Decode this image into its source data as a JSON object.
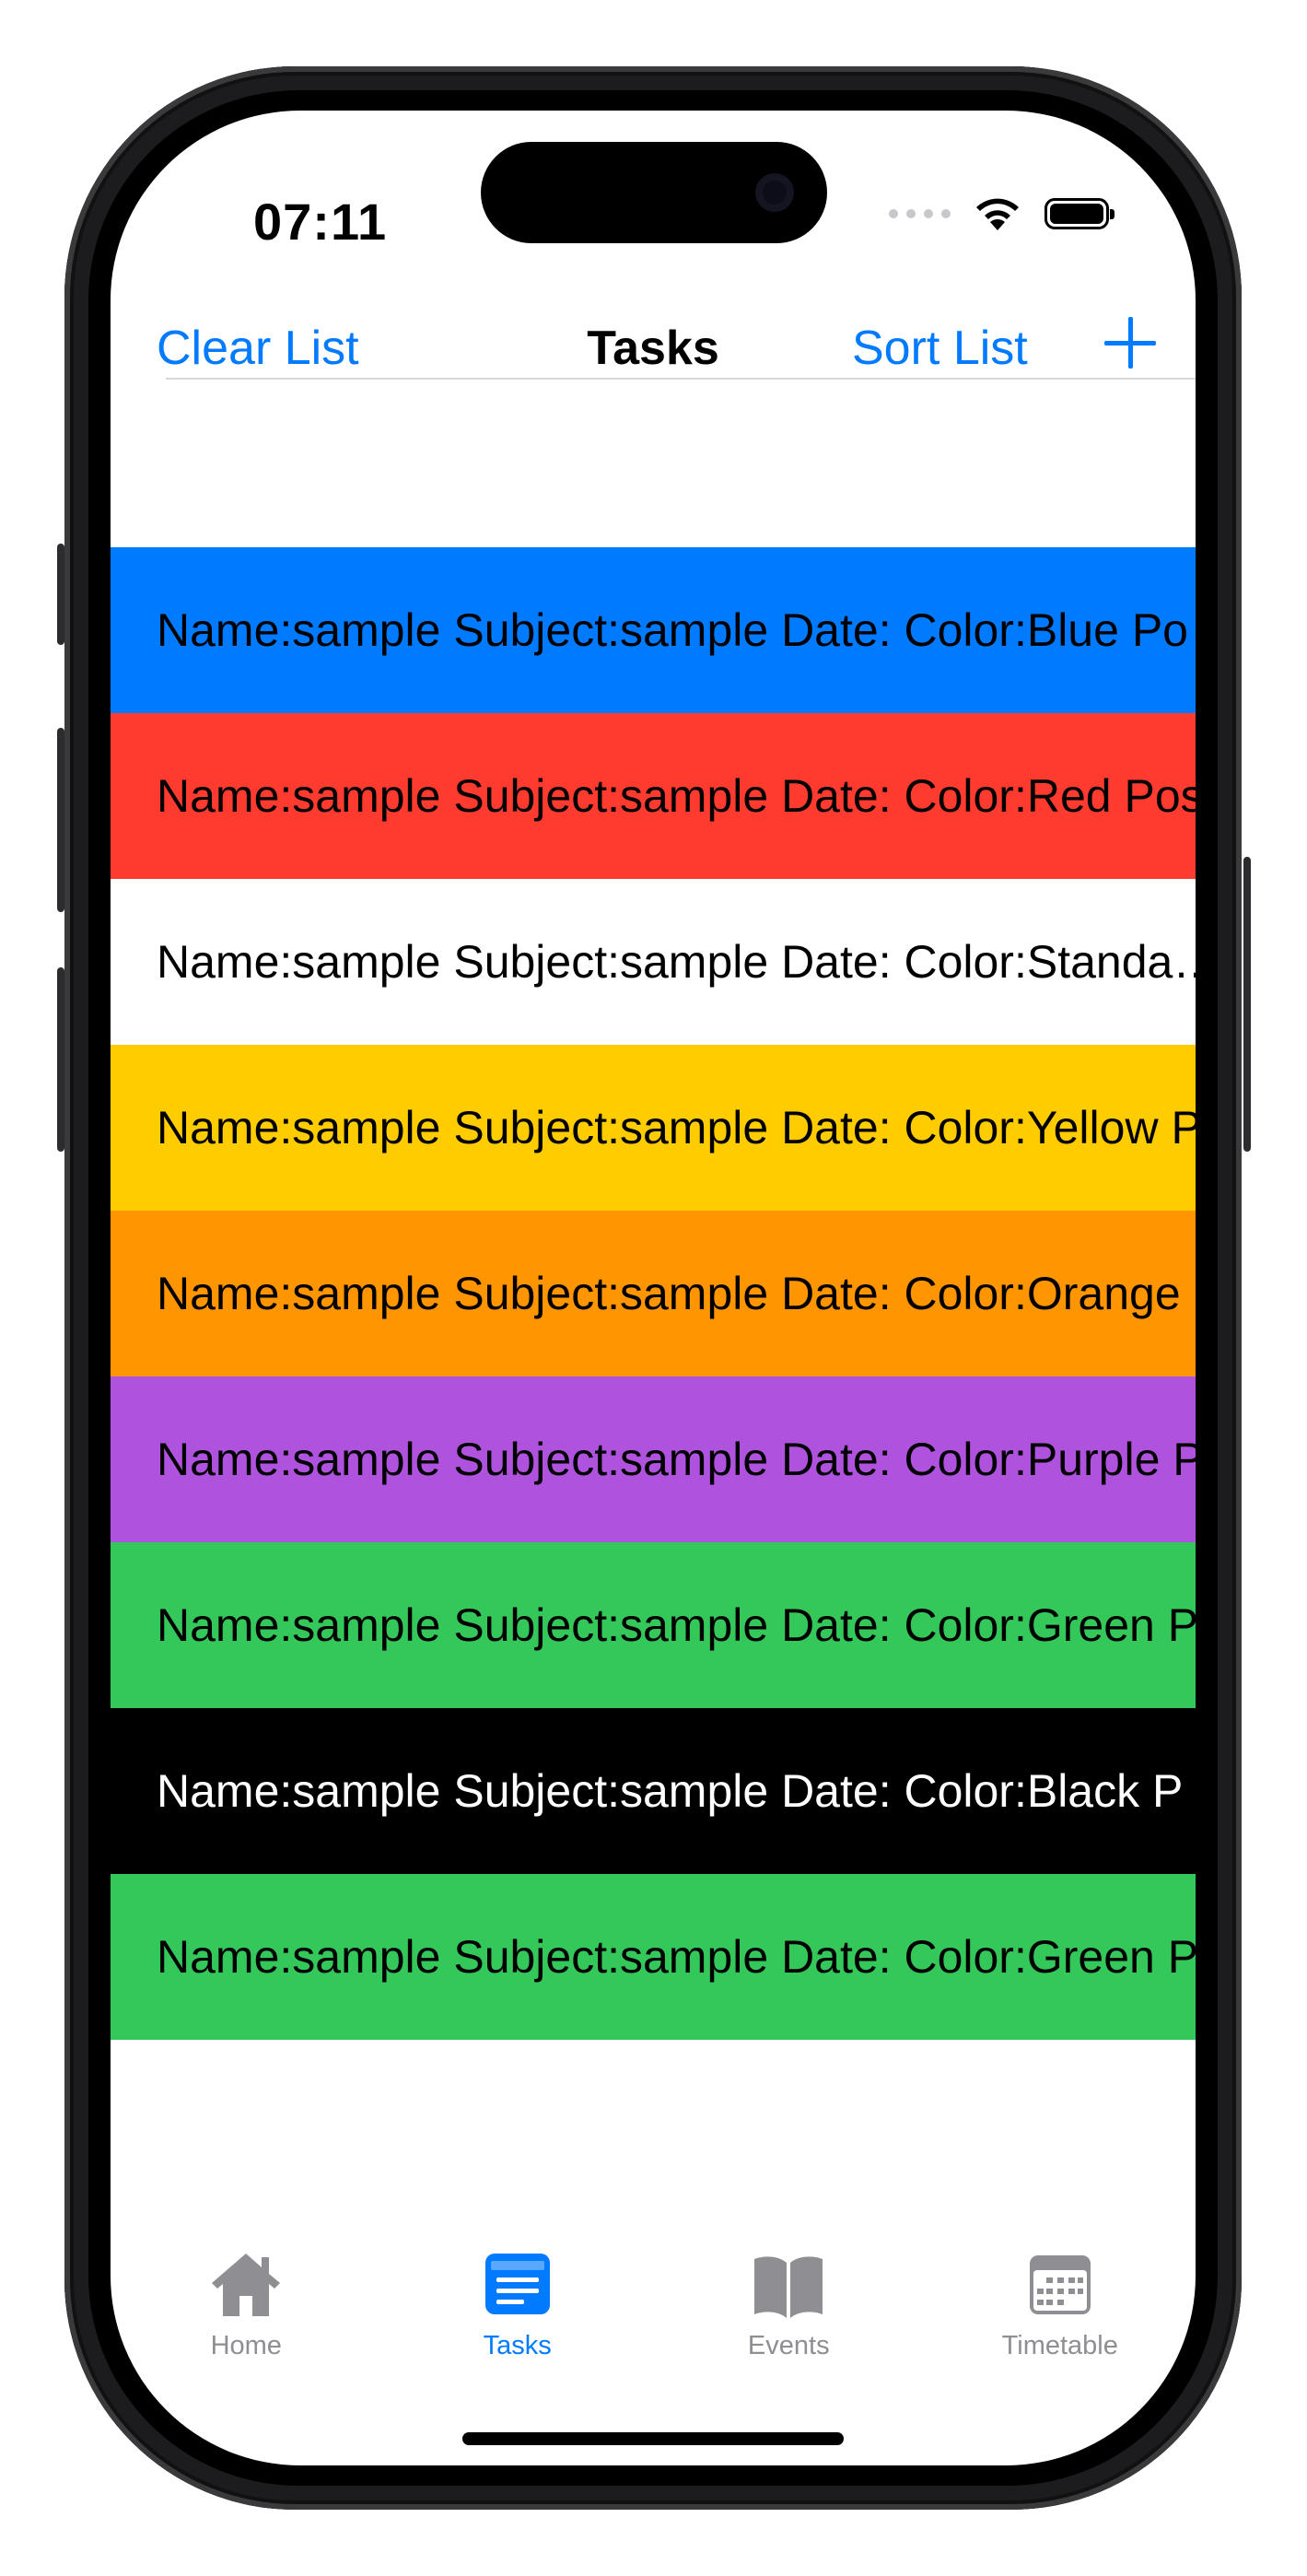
{
  "status_bar": {
    "time": "07:11"
  },
  "nav": {
    "left_button": "Clear List",
    "title": "Tasks",
    "sort_button": "Sort List",
    "add_icon": "plus-icon"
  },
  "tasks": [
    {
      "text": "Name:sample Subject:sample Date: Color:Blue Po",
      "bg": "#007aff",
      "fg": "#000000"
    },
    {
      "text": "Name:sample Subject:sample Date: Color:Red Pos",
      "bg": "#ff3b30",
      "fg": "#000000"
    },
    {
      "text": "Name:sample Subject:sample Date: Color:Standa…",
      "bg": "#ffffff",
      "fg": "#000000"
    },
    {
      "text": "Name:sample Subject:sample Date: Color:Yellow P",
      "bg": "#ffcc00",
      "fg": "#000000"
    },
    {
      "text": "Name:sample Subject:sample Date: Color:Orange",
      "bg": "#ff9500",
      "fg": "#000000"
    },
    {
      "text": "Name:sample Subject:sample Date: Color:Purple P",
      "bg": "#af52de",
      "fg": "#000000"
    },
    {
      "text": "Name:sample Subject:sample Date: Color:Green P",
      "bg": "#34c759",
      "fg": "#000000"
    },
    {
      "text": "Name:sample Subject:sample Date: Color:Black P",
      "bg": "#000000",
      "fg": "#ffffff"
    },
    {
      "text": "Name:sample Subject:sample Date: Color:Green P",
      "bg": "#34c759",
      "fg": "#000000"
    }
  ],
  "tabs": [
    {
      "label": "Home",
      "icon": "house-icon",
      "active": false
    },
    {
      "label": "Tasks",
      "icon": "list-icon",
      "active": true
    },
    {
      "label": "Events",
      "icon": "book-icon",
      "active": false
    },
    {
      "label": "Timetable",
      "icon": "calendar-icon",
      "active": false
    }
  ],
  "colors": {
    "accent": "#007aff",
    "inactive": "#8e8e93"
  }
}
